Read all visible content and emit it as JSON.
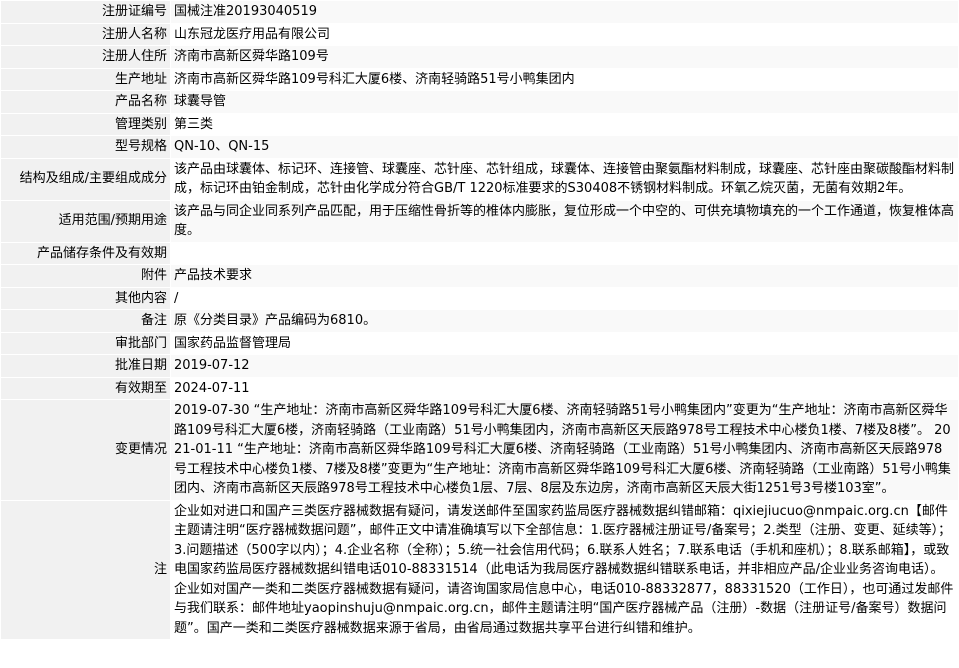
{
  "rows": [
    {
      "label": "注册证编号",
      "value": "国械注准20193040519"
    },
    {
      "label": "注册人名称",
      "value": "山东冠龙医疗用品有限公司"
    },
    {
      "label": "注册人住所",
      "value": "济南市高新区舜华路109号"
    },
    {
      "label": "生产地址",
      "value": "济南市高新区舜华路109号科汇大厦6楼、济南轻骑路51号小鸭集团内"
    },
    {
      "label": "产品名称",
      "value": "球囊导管"
    },
    {
      "label": "管理类别",
      "value": "第三类"
    },
    {
      "label": "型号规格",
      "value": "QN-10、QN-15"
    },
    {
      "label": "结构及组成/主要组成成分",
      "value": "该产品由球囊体、标记环、连接管、球囊座、芯针座、芯针组成，球囊体、连接管由聚氨酯材料制成，球囊座、芯针座由聚碳酸酯材料制成，标记环由铂金制成，芯针由化学成分符合GB/T 1220标准要求的S30408不锈钢材料制成。环氧乙烷灭菌，无菌有效期2年。"
    },
    {
      "label": "适用范围/预期用途",
      "value": "该产品与同企业同系列产品匹配，用于压缩性骨折等的椎体内膨胀，复位形成一个中空的、可供充填物填充的一个工作通道，恢复椎体高度。"
    },
    {
      "label": "产品储存条件及有效期",
      "value": ""
    },
    {
      "label": "附件",
      "value": "产品技术要求"
    },
    {
      "label": "其他内容",
      "value": "/"
    },
    {
      "label": "备注",
      "value": "原《分类目录》产品编码为6810。"
    },
    {
      "label": "审批部门",
      "value": "国家药品监督管理局"
    },
    {
      "label": "批准日期",
      "value": "2019-07-12"
    },
    {
      "label": "有效期至",
      "value": "2024-07-11"
    },
    {
      "label": "变更情况",
      "value": "2019-07-30 “生产地址：济南市高新区舜华路109号科汇大厦6楼、济南轻骑路51号小鸭集团内”变更为“生产地址：济南市高新区舜华路109号科汇大厦6楼，济南轻骑路（工业南路）51号小鸭集团内，济南市高新区天辰路978号工程技术中心楼负1楼、7楼及8楼”。 2021-01-11 “生产地址：济南市高新区舜华路109号科汇大厦6楼、济南轻骑路（工业南路）51号小鸭集团内、济南市高新区天辰路978号工程技术中心楼负1楼、7楼及8楼”变更为“生产地址：济南市高新区舜华路109号科汇大厦6楼、济南轻骑路（工业南路）51号小鸭集团内、济南市高新区天辰路978号工程技术中心楼负1层、7层、8层及东边房，济南市高新区天辰大街1251号3号楼103室”。"
    },
    {
      "label": "注",
      "value": "企业如对进口和国产三类医疗器械数据有疑问，请发送邮件至国家药监局医疗器械数据纠错邮箱：qixiejiucuo@nmpaic.org.cn【邮件主题请注明“医疗器械数据问题”，邮件正文中请准确填写以下全部信息：1.医疗器械注册证号/备案号；2.类型（注册、变更、延续等）；3.问题描述（500字以内）；4.企业名称（全称）；5.统一社会信用代码；6.联系人姓名；7.联系电话（手机和座机）；8.联系邮箱】，或致电国家药监局医疗器械数据纠错电话010-88331514（此电话为我局医疗器械数据纠错联系电话，并非相应产品/企业业务咨询电话）。企业如对国产一类和二类医疗器械数据有疑问，请咨询国家局信息中心，电话010-88332877，88331520（工作日），也可通过发邮件与我们联系：邮件地址yaopinshuju@nmpaic.org.cn，邮件主题请注明“国产医疗器械产品（注册）-数据（注册证号/备案号）数据问题”。国产一类和二类医疗器械数据来源于省局，由省局通过数据共享平台进行纠错和维护。"
    }
  ]
}
